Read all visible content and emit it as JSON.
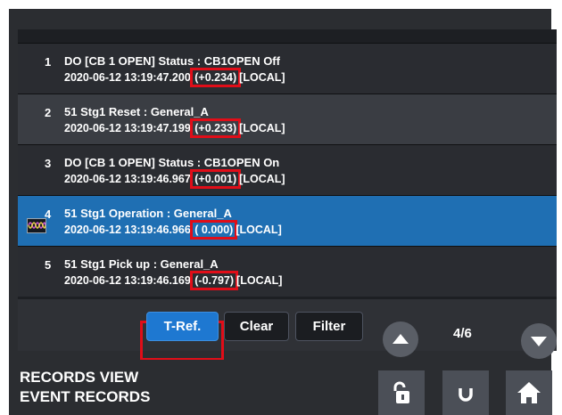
{
  "events": [
    {
      "number": "1",
      "title": "DO [CB 1 OPEN] Status : CB1OPEN Off",
      "timestamp": "2020-06-12 13:19:47.200",
      "delta": "(+0.234)",
      "source": "[LOCAL]"
    },
    {
      "number": "2",
      "title": "51 Stg1 Reset : General_A",
      "timestamp": "2020-06-12 13:19:47.199",
      "delta": "(+0.233)",
      "source": "[LOCAL]"
    },
    {
      "number": "3",
      "title": "DO [CB 1 OPEN] Status : CB1OPEN On",
      "timestamp": "2020-06-12 13:19:46.967",
      "delta": "(+0.001)",
      "source": "[LOCAL]"
    },
    {
      "number": "4",
      "title": "51 Stg1 Operation : General_A",
      "timestamp": "2020-06-12 13:19:46.966",
      "delta": "( 0.000)",
      "source": "[LOCAL]"
    },
    {
      "number": "5",
      "title": "51 Stg1 Pick up : General_A",
      "timestamp": "2020-06-12 13:19:46.169",
      "delta": "(-0.797)",
      "source": "[LOCAL]"
    }
  ],
  "toolbar": {
    "tref_label": "T-Ref.",
    "clear_label": "Clear",
    "filter_label": "Filter",
    "page_indicator": "4/6"
  },
  "footer": {
    "line1": "RECORDS VIEW",
    "line2": "EVENT RECORDS"
  },
  "icons": {
    "waveform": "waveform-icon",
    "up": "arrow-up-icon",
    "down": "arrow-down-icon",
    "lock": "unlock-icon",
    "refresh": "refresh-icon",
    "home": "home-icon"
  },
  "colors": {
    "selected_row": "#1f6fb3",
    "highlight": "#e10d18",
    "tref_button": "#1e78d1"
  }
}
